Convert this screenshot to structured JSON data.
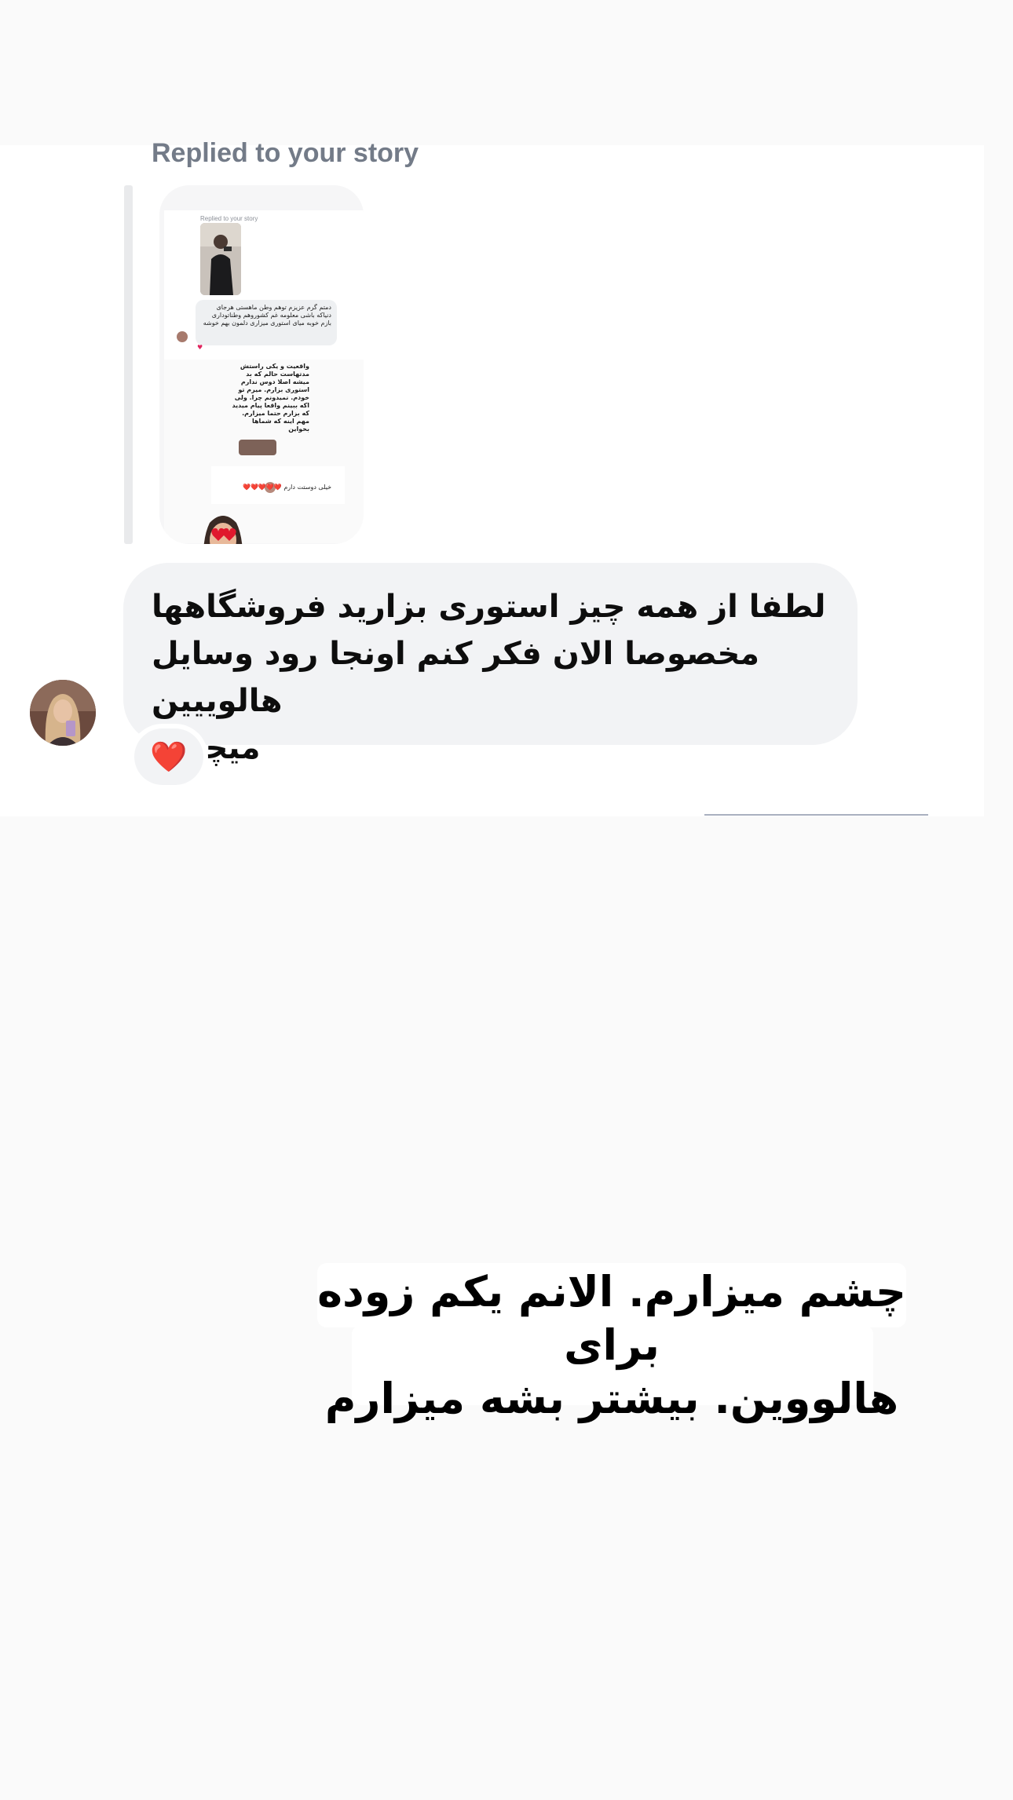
{
  "story_reply": {
    "label": "Replied to your story",
    "thumbnail": {
      "label": "Replied to your story",
      "bubble_text": "دمتم گرم عزیزم توهم وطن ماهستی هرجای دنیاکه باشی معلومه غم کشوروهم وطناتوداری بازم خوبه میای استوری میزاری دلمون بهم خوشه",
      "reply_text": "واقعیت و یکی راستش مدتهاست حالم که بد میشه اصلا دوس ندارم استوری بزارم. میرم تو خودم. نمیدونم چرا. ولی اکه ببینم واقعا پیام میدید که بزارم حتما میزارم. مهم اینه که شماها بخواین",
      "chip_text": "خیلی دوستت دارم ❤️❤️❤️❤️❤️"
    }
  },
  "message": {
    "lines": [
      "لطفا از همه چیز استوری بزارید فروشگاهها",
      "مخصوصا الان فکر کنم اونجا رود وسایل هالوییین",
      "میچینن"
    ],
    "reaction": "❤️"
  },
  "caption": {
    "lines": [
      "چشم میزارم. الانم یکم زوده برای",
      "هالووین. بیشتر بشه میزارم"
    ]
  },
  "colors": {
    "background": "#fafafa",
    "card": "#ffffff",
    "bubble": "#f2f3f5",
    "label": "#737b88",
    "heart": "#e0182d"
  }
}
